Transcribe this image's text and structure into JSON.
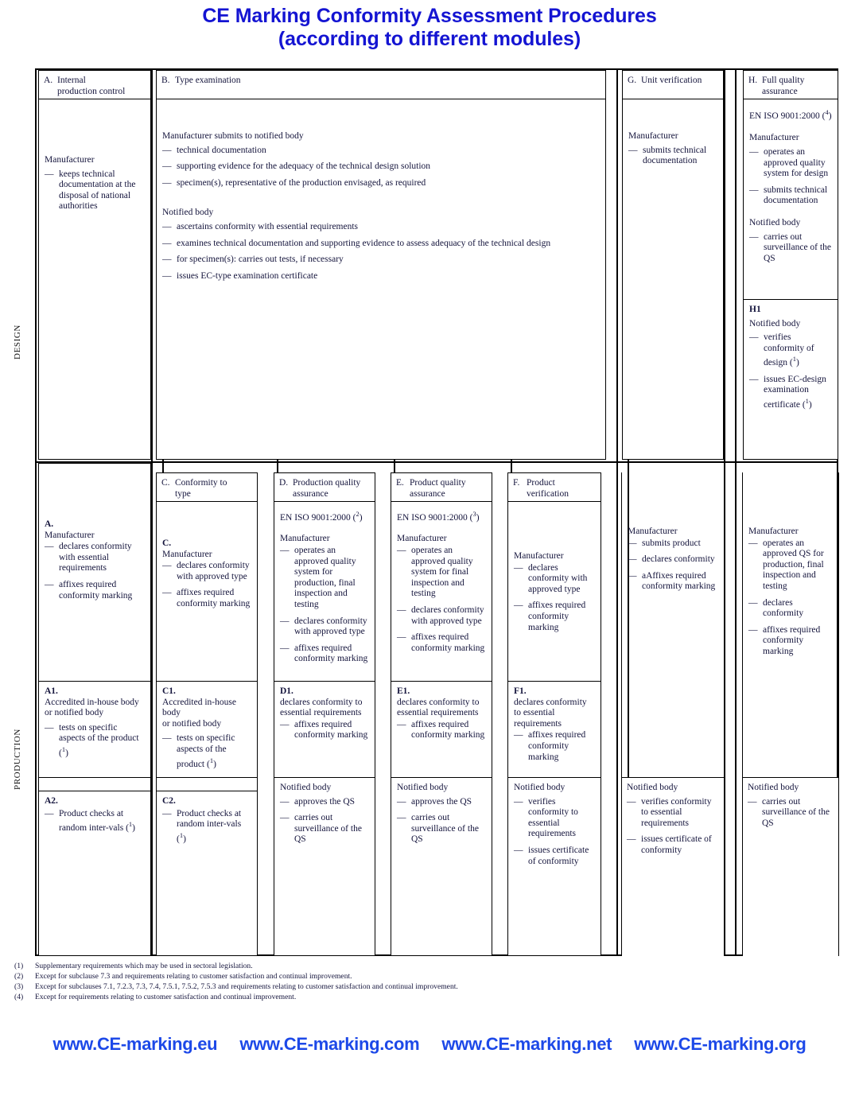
{
  "title": {
    "line1": "CE Marking Conformity Assessment Procedures",
    "line2": "(according to different modules)"
  },
  "bands": {
    "design": "DESIGN",
    "production": "PRODUCTION"
  },
  "design": {
    "A": {
      "letter": "A.",
      "title_line1": "Internal",
      "title_line2": "production control",
      "actor": "Manufacturer",
      "items": [
        "keeps technical documentation at the disposal of national authorities"
      ]
    },
    "B": {
      "letter": "B.",
      "title": "Type examination",
      "actor1": "Manufacturer submits to notified body",
      "items1": [
        "technical documentation",
        "supporting evidence for the adequacy of the technical design solution",
        "specimen(s), representative of the production envisaged, as required"
      ],
      "actor2": "Notified body",
      "items2": [
        "ascertains conformity with essential requirements",
        "examines technical documentation and supporting evidence to assess adequacy of the technical design",
        "for specimen(s): carries out tests, if necessary",
        "issues EC-type examination certificate"
      ]
    },
    "G": {
      "letter": "G.",
      "title": "Unit verification",
      "actor": "Manufacturer",
      "items": [
        "submits technical documentation"
      ]
    },
    "H": {
      "letter": "H.",
      "title_line1": "Full quality",
      "title_line2": "assurance",
      "standard": "EN ISO 9001:2000 (",
      "standard_note": "4",
      "standard_end": ")",
      "actor1": "Manufacturer",
      "items1": [
        "operates an approved quality system for design",
        "submits technical documentation"
      ],
      "actor2": "Notified body",
      "items2": [
        "carries out surveillance of the QS"
      ]
    },
    "H1": {
      "code": "H1",
      "actor": "Notified body",
      "item1_text": "verifies conformity of design (",
      "item1_note": "1",
      "item1_end": ")",
      "item2_text": "issues EC-design examination certificate (",
      "item2_note": "1",
      "item2_end": ")"
    }
  },
  "production": {
    "A": {
      "code": "A.",
      "actor": "Manufacturer",
      "items": [
        "declares conformity with essential requirements",
        "affixes required conformity marking"
      ]
    },
    "A1": {
      "code": "A1.",
      "line1": "Accredited in-house body",
      "line2": "or notified body",
      "item_text": "tests on specific aspects of the product (",
      "item_note": "1",
      "item_end": ")"
    },
    "A2": {
      "code": "A2.",
      "item_text": "Product checks at random inter-vals (",
      "item_note": "1",
      "item_end": ")"
    },
    "C_head": {
      "letter": "C.",
      "title_line1": "Conformity to",
      "title_line2": "type"
    },
    "C": {
      "code": "C.",
      "actor": "Manufacturer",
      "items": [
        "declares conformity with approved type",
        "affixes required conformity marking"
      ]
    },
    "C1": {
      "code": "C1.",
      "line1": "Accredited in-house body",
      "line2": "or notified body",
      "item_text": "tests on specific aspects of the product (",
      "item_note": "1",
      "item_end": ")"
    },
    "C2": {
      "code": "C2.",
      "item_text": "Product checks at random inter-vals (",
      "item_note": "1",
      "item_end": ")"
    },
    "D_head": {
      "letter": "D.",
      "title_line1": "Production quality",
      "title_line2": "assurance"
    },
    "D": {
      "standard": "EN ISO 9001:2000 (",
      "standard_note": "2",
      "standard_end": ")",
      "actor": "Manufacturer",
      "items": [
        "operates an approved quality system for production, final inspection and testing",
        "declares conformity with approved type",
        "affixes required conformity marking"
      ]
    },
    "D1": {
      "code": "D1.",
      "lead": "declares conformity to essential requirements",
      "items": [
        "affixes required conformity marking"
      ]
    },
    "D_nb": {
      "actor": "Notified body",
      "items": [
        "approves the QS",
        "carries out surveillance of the QS"
      ]
    },
    "E_head": {
      "letter": "E.",
      "title_line1": "Product quality",
      "title_line2": "assurance"
    },
    "E": {
      "standard": "EN ISO 9001:2000 (",
      "standard_note": "3",
      "standard_end": ")",
      "actor": "Manufacturer",
      "items": [
        "operates an approved quality system for final inspection and testing",
        "declares conformity with approved type",
        "affixes required conformity marking"
      ]
    },
    "E1": {
      "code": "E1.",
      "lead": "declares conformity to essential requirements",
      "items": [
        "affixes required conformity marking"
      ]
    },
    "E_nb": {
      "actor": "Notified body",
      "items": [
        "approves the QS",
        "carries out surveillance of the QS"
      ]
    },
    "F_head": {
      "letter": "F.",
      "title_line1": "Product",
      "title_line2": "verification"
    },
    "F": {
      "actor": "Manufacturer",
      "items": [
        "declares conformity with approved type",
        "affixes required conformity marking"
      ]
    },
    "F1": {
      "code": "F1.",
      "lead": "declares conformity to essential requirements",
      "items": [
        "affixes required conformity marking"
      ]
    },
    "F_nb": {
      "actor": "Notified body",
      "items": [
        "verifies conformity to essential requirements",
        "issues certificate of conformity"
      ]
    },
    "G": {
      "actor": "Manufacturer",
      "items": [
        "submits product",
        "declares conformity",
        "aAffixes required conformity marking"
      ]
    },
    "G_nb": {
      "actor": "Notified body",
      "items": [
        "verifies conformity to essential requirements",
        "issues certificate of conformity"
      ]
    },
    "H": {
      "actor": "Manufacturer",
      "items": [
        "operates an approved QS for production, final inspection and testing",
        "declares conformity",
        "affixes required conformity marking"
      ]
    },
    "H_nb": {
      "actor": "Notified body",
      "items": [
        "carries out surveillance of the QS"
      ]
    }
  },
  "footnotes": [
    {
      "mark": "(1)",
      "text": "Supplementary requirements which may be used in sectoral legislation."
    },
    {
      "mark": "(2)",
      "text": "Except for subclause 7.3 and requirements relating to customer satisfaction and continual improvement."
    },
    {
      "mark": "(3)",
      "text": "Except for subclauses 7.1, 7.2.3, 7.3, 7.4, 7.5.1, 7.5.2, 7.5.3 and requirements relating to customer satisfaction and continual improvement."
    },
    {
      "mark": "(4)",
      "text": "Except for requirements relating to customer satisfaction and continual improvement."
    }
  ],
  "footer_links": [
    "www.CE-marking.eu",
    "www.CE-marking.com",
    "www.CE-marking.net",
    "www.CE-marking.org"
  ],
  "colors": {
    "title": "#1414d2",
    "footer_link": "#1d49e8",
    "text": "#14143c",
    "rule": "#000000"
  }
}
